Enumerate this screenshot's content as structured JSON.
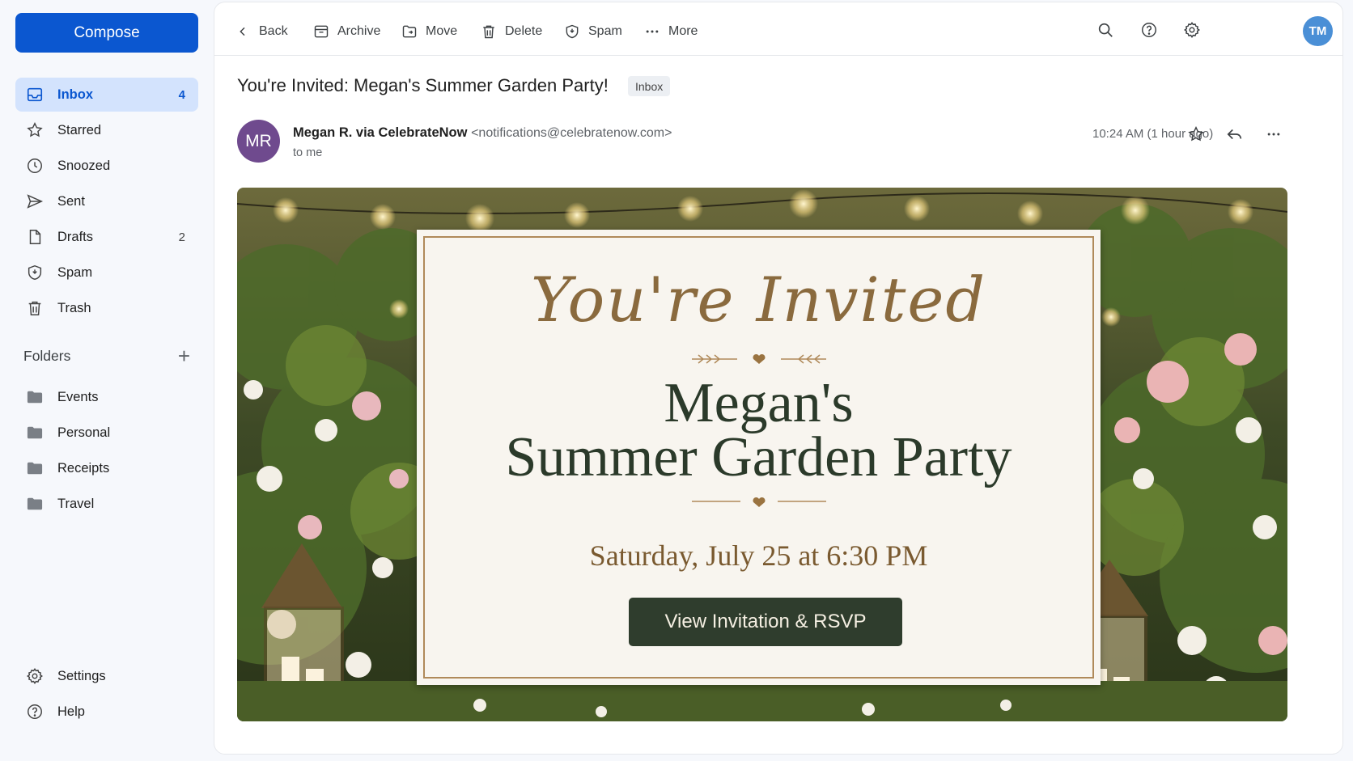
{
  "sidebar": {
    "compose_label": "Compose",
    "nav": [
      {
        "label": "Inbox",
        "count": "4",
        "icon": "inbox-icon"
      },
      {
        "label": "Starred",
        "count": "",
        "icon": "star-icon"
      },
      {
        "label": "Snoozed",
        "count": "",
        "icon": "clock-icon"
      },
      {
        "label": "Sent",
        "count": "",
        "icon": "send-icon"
      },
      {
        "label": "Drafts",
        "count": "2",
        "icon": "file-icon"
      },
      {
        "label": "Spam",
        "count": "",
        "icon": "shield-icon"
      },
      {
        "label": "Trash",
        "count": "",
        "icon": "trash-icon"
      }
    ],
    "folders_label": "Folders",
    "folders": [
      "Events",
      "Personal",
      "Receipts",
      "Travel"
    ],
    "bottom": [
      {
        "label": "Settings",
        "icon": "gear-icon"
      },
      {
        "label": "Help",
        "icon": "help-icon"
      }
    ]
  },
  "toolbar": {
    "back": "Back",
    "archive": "Archive",
    "move": "Move",
    "delete": "Delete",
    "spam": "Spam",
    "more": "More",
    "user_initials": "TM"
  },
  "message": {
    "subject": "You're Invited: Megan's Summer Garden Party!",
    "label_chip": "Inbox",
    "sender_initials": "MR",
    "sender_name": "Megan R. via CelebrateNow",
    "sender_email": "<notifications@celebratenow.com>",
    "recipient": "to me",
    "timestamp": "10:24 AM (1 hour ago)"
  },
  "invitation": {
    "script_heading": "You're Invited",
    "name_line": "Megan's",
    "title_line": "Summer Garden Party",
    "date_line": "Saturday, July 25 at 6:30 PM",
    "button_label": "View Invitation & RSVP"
  },
  "colors": {
    "accent": "#0b57d0",
    "active_nav_bg": "#d3e3fd",
    "invite_green": "#2f3d2d",
    "invite_gold": "#b08a5a"
  }
}
